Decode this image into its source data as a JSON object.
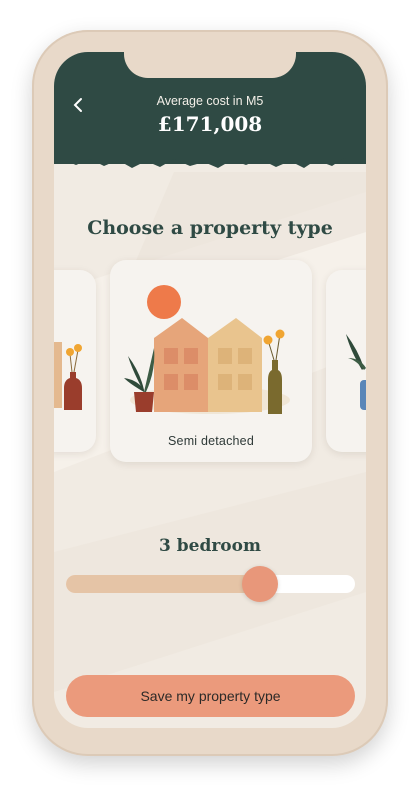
{
  "header": {
    "back_icon": "chevron-left-icon",
    "subtitle": "Average cost in M5",
    "value": "£171,008"
  },
  "main": {
    "title": "Choose a property type",
    "carousel": {
      "cards": [
        {
          "label": "",
          "position": "previous"
        },
        {
          "label": "Semi detached",
          "position": "current",
          "selected": true
        },
        {
          "label": "",
          "position": "next"
        }
      ]
    },
    "bedrooms": {
      "label": "3 bedroom",
      "slider_fraction": 0.67
    },
    "save_button": {
      "label": "Save my property type"
    }
  },
  "colors": {
    "header_bg": "#2f4a44",
    "title_text": "#2f4a44",
    "accent": "#eb9a7c",
    "slider_fill": "#e5c4a6",
    "screen_bg": "#f1ebe3",
    "phone_frame": "#e8d9c9"
  }
}
